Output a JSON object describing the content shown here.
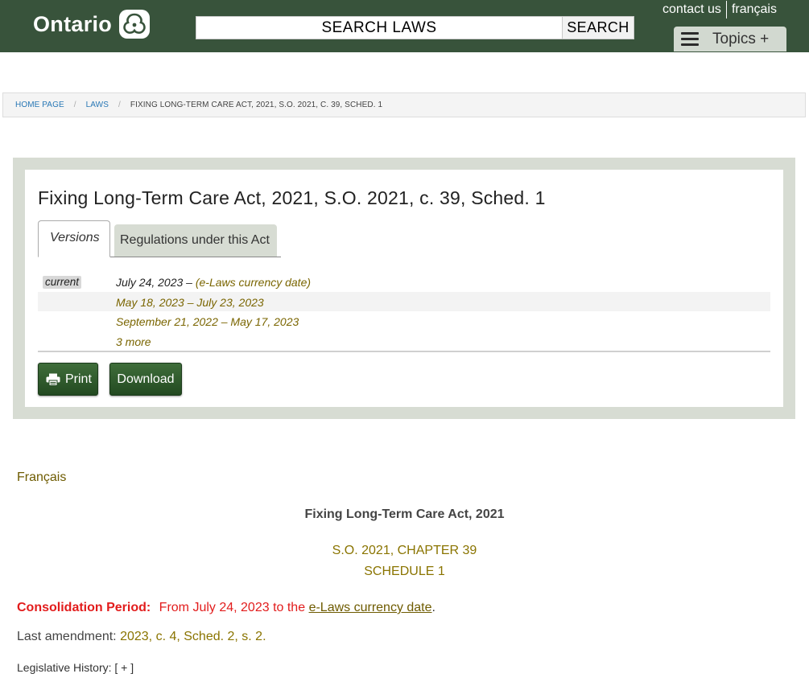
{
  "header": {
    "logo_text": "Ontario",
    "logo_icon": "trillium-icon",
    "search_placeholder": "SEARCH LAWS",
    "search_button": "SEARCH",
    "contact_link": "contact us",
    "language_link": "français",
    "topics_button": "Topics +",
    "colors": {
      "bar": "#38533b",
      "topics": "#d2d9d0"
    }
  },
  "breadcrumb": {
    "items": [
      "HOME PAGE",
      "LAWS"
    ],
    "current": "FIXING LONG-TERM CARE ACT, 2021, S.O. 2021, C. 39, SCHED. 1"
  },
  "act": {
    "title": "Fixing Long-Term Care Act, 2021, S.O. 2021, c. 39, Sched. 1",
    "tabs": [
      "Versions",
      "Regulations under this Act"
    ],
    "versions": [
      {
        "badge": "current",
        "date": "July 24, 2023 –",
        "note": "(e-Laws currency date)"
      },
      {
        "range": "May 18, 2023 – July 23, 2023"
      },
      {
        "range": "September 21, 2022 – May 17, 2023"
      },
      {
        "range": "3 more"
      }
    ],
    "print_button": "Print",
    "download_button": "Download"
  },
  "document": {
    "french_link": "Français",
    "title": "Fixing Long-Term Care Act, 2021",
    "chapter": "S.O. 2021, CHAPTER 39",
    "schedule": "SCHEDULE 1",
    "consolidation_label": "Consolidation Period:",
    "consolidation_text": "From July 24, 2023 to the",
    "consolidation_link": "e-Laws currency date",
    "consolidation_end": ".",
    "last_amendment_label": "Last amendment:",
    "last_amendment_value": "2023, c. 4, Sched. 2, s. 2.",
    "history_label": "Legislative History:",
    "history_toggle": "[ + ]"
  }
}
